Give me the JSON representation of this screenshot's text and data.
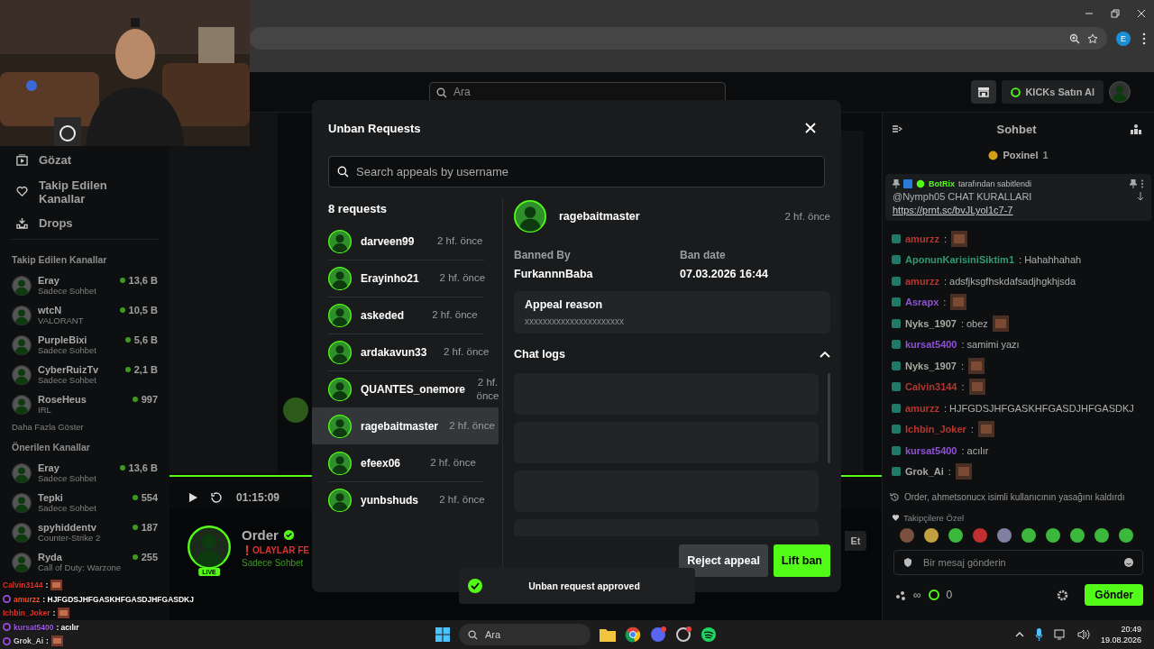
{
  "browser": {
    "profile_initial": "E"
  },
  "kick_header": {
    "search": {
      "placeholder": "Ara"
    },
    "buy_button": "KICKs Satın Al"
  },
  "sidebar": {
    "nav": [
      {
        "label": "Gözat",
        "kind": "browse"
      },
      {
        "label": "Takip Edilen Kanallar",
        "kind": "heart"
      },
      {
        "label": "Drops",
        "kind": "drops"
      }
    ],
    "sections": [
      {
        "title": "Takip Edilen Kanallar",
        "more": "Daha Fazla Göster",
        "channels": [
          {
            "name": "Eray",
            "category": "Sadece Sohbet",
            "viewers": "13,6 B"
          },
          {
            "name": "wtcN",
            "category": "VALORANT",
            "viewers": "10,5 B"
          },
          {
            "name": "PurpleBixi",
            "category": "Sadece Sohbet",
            "viewers": "5,6 B"
          },
          {
            "name": "CyberRuizTv",
            "category": "Sadece Sohbet",
            "viewers": "2,1 B"
          },
          {
            "name": "RoseHeus",
            "category": "IRL",
            "viewers": "997"
          }
        ]
      },
      {
        "title": "Önerilen Kanallar",
        "channels": [
          {
            "name": "Eray",
            "category": "Sadece Sohbet",
            "viewers": "13,6 B"
          },
          {
            "name": "Tepki",
            "category": "Sadece Sohbet",
            "viewers": "554"
          },
          {
            "name": "spyhiddentv",
            "category": "Counter-Strike 2",
            "viewers": "187"
          },
          {
            "name": "Ryda",
            "category": "Call of Duty: Warzone",
            "viewers": "255"
          }
        ]
      }
    ]
  },
  "player": {
    "time": "01:15:09"
  },
  "stream_info": {
    "streamer": "Order",
    "live_badge": "LIVE",
    "title": "❗OLAYLAR FE",
    "category": "Sadece Sohbet",
    "follow_fragment": "Et"
  },
  "chat": {
    "title": "Sohbet",
    "gift": {
      "user": "Poxinel",
      "count": "1"
    },
    "pinned": {
      "pinned_by": "BotRix",
      "note": "tarafından sabitlendi",
      "text": "@Nymph05 CHAT KURALLARI",
      "link": "https://prnt.sc/bvJLyol1c7-7"
    },
    "messages": [
      {
        "user": "amurzz",
        "color": "#b8362e",
        "text": ":",
        "emote": true
      },
      {
        "user": "AponunKarisiniSiktim1",
        "color": "#2f9a72",
        "text": ": Hahahhahah",
        "emote": false
      },
      {
        "user": "amurzz",
        "color": "#b8362e",
        "text": ": adsfjksgfhskdafsadjhgkhjsda",
        "emote": false
      },
      {
        "user": "Asrapx",
        "color": "#8f52d6",
        "text": ":",
        "emote": true
      },
      {
        "user": "Nyks_1907",
        "color": "#a4aca0",
        "text": ": obez",
        "emote": true
      },
      {
        "user": "kursat5400",
        "color": "#8f52d6",
        "text": ": samimi yazı",
        "emote": false
      },
      {
        "user": "Nyks_1907",
        "color": "#a4aca0",
        "text": ":",
        "emote": true
      },
      {
        "user": "Calvin3144",
        "color": "#b8362e",
        "text": ":",
        "emote": true
      },
      {
        "user": "amurzz",
        "color": "#b8362e",
        "text": ": HJFGDSJHFGASKHFGASDJHFGASDKJ",
        "emote": false
      },
      {
        "user": "Ichbin_Joker",
        "color": "#b8362e",
        "text": ":",
        "emote": true
      },
      {
        "user": "kursat5400",
        "color": "#8f52d6",
        "text": ": acılır",
        "emote": false
      },
      {
        "user": "Grok_Ai",
        "color": "#a8a8a8",
        "text": ":",
        "emote": true
      }
    ],
    "system": "Order, ahmetsonucx isimli kullanıcının yasağını kaldırdı",
    "emote_label": "Takipçilere Özel",
    "input": {
      "placeholder": "Bir mesaj gönderin"
    },
    "infinity": "∞",
    "points": "0",
    "send": "Gönder"
  },
  "modal": {
    "title": "Unban Requests",
    "search": {
      "placeholder": "Search appeals by username"
    },
    "count": "8 requests",
    "requests": [
      {
        "username": "darveen99",
        "time": "2 hf. önce",
        "selected": false
      },
      {
        "username": "Erayinho21",
        "time": "2 hf. önce",
        "selected": false
      },
      {
        "username": "askeded",
        "time": "2 hf. önce",
        "selected": false
      },
      {
        "username": "ardakavun33",
        "time": "2 hf. önce",
        "selected": false
      },
      {
        "username": "QUANTES_onemore",
        "time": "2 hf. önce",
        "selected": false
      },
      {
        "username": "ragebaitmaster",
        "time": "2 hf. önce",
        "selected": true
      },
      {
        "username": "efeex06",
        "time": "2 hf. önce",
        "selected": false
      },
      {
        "username": "yunbshuds",
        "time": "2 hf. önce",
        "selected": false
      }
    ],
    "detail": {
      "username": "ragebaitmaster",
      "time": "2 hf. önce",
      "banned_by_label": "Banned By",
      "banned_by": "FurkannnBaba",
      "ban_date_label": "Ban date",
      "ban_date": "07.03.2026 16:44",
      "reason_label": "Appeal reason",
      "reason": "xxxxxxxxxxxxxxxxxxxxxx",
      "chat_logs_label": "Chat logs",
      "chat_logs_expanded": true,
      "reject_button": "Reject appeal",
      "lift_button": "Lift ban"
    }
  },
  "toast": {
    "text": "Unban request approved"
  },
  "overlay_chat": [
    {
      "user": "Calvin3144",
      "color": "#e8342c",
      "badge": false,
      "text": ":",
      "emote": true
    },
    {
      "user": "amurzz",
      "color": "#f0542c",
      "badge": true,
      "text": ": HJFGDSJHFGASKHFGASDJHFGASDKJ",
      "emote": false
    },
    {
      "user": "Ichbin_Joker",
      "color": "#e8342c",
      "badge": false,
      "text": ":",
      "emote": true
    },
    {
      "user": "kursat5400",
      "color": "#a05ce6",
      "badge": true,
      "text": ": acılır",
      "emote": false
    },
    {
      "user": "Grok_Ai",
      "color": "#d8d8d8",
      "badge": true,
      "text": ":",
      "emote": true
    }
  ],
  "taskbar": {
    "search": "Ara",
    "time": "20:49",
    "date": "19.08.2026"
  }
}
